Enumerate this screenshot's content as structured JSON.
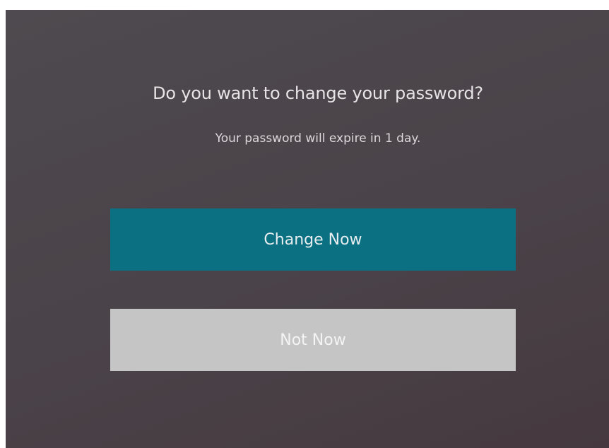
{
  "dialog": {
    "title": "Do you want to change your password?",
    "message": "Your password will expire in 1 day.",
    "primary_button": "Change Now",
    "secondary_button": "Not Now"
  },
  "colors": {
    "primary_button_bg": "#0a7082",
    "secondary_button_bg": "#c6c5c6",
    "dialog_bg": "#4a4349"
  }
}
